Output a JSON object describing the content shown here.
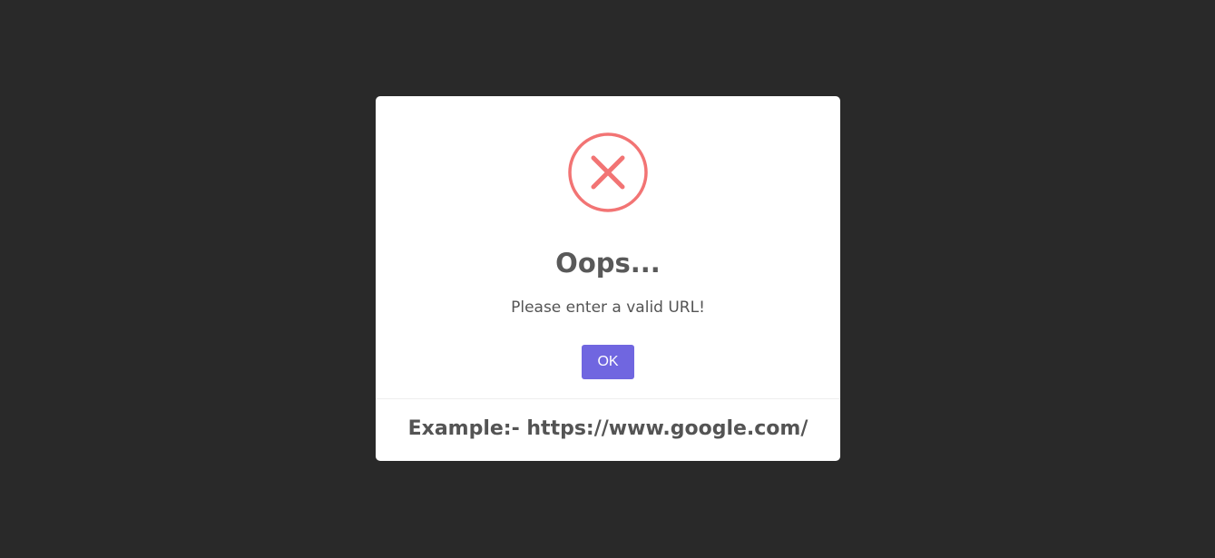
{
  "background_color": "#292929",
  "dialog": {
    "icon": "error-x-icon",
    "icon_color": "#f27474",
    "title": "Oops...",
    "message": "Please enter a valid URL!",
    "confirm_label": "OK",
    "confirm_color": "#7066e0",
    "footer": "Example:- https://www.google.com/"
  }
}
